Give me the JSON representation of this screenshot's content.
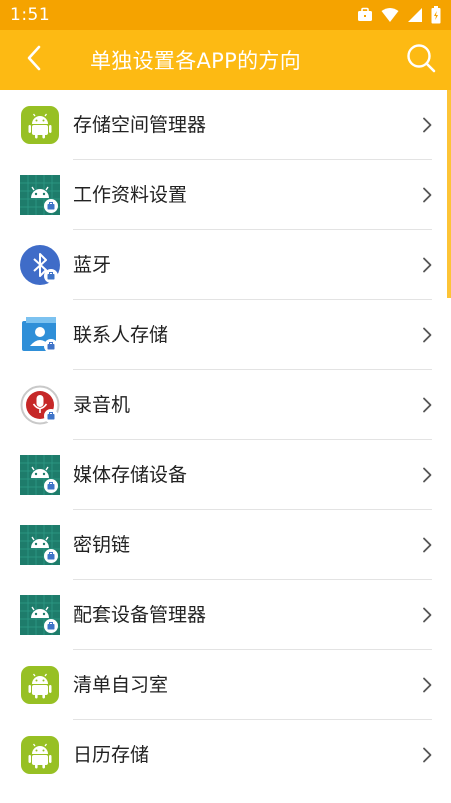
{
  "status_bar": {
    "time": "1:51",
    "icons": [
      "briefcase-icon",
      "wifi-icon",
      "signal-icon",
      "battery-icon"
    ]
  },
  "app_bar": {
    "title": "单独设置各APP的方向",
    "back_icon": "back-arrow-icon",
    "search_icon": "search-icon"
  },
  "colors": {
    "status_bar": "#F5A300",
    "app_bar": "#FDBA13",
    "divider": "#e3e3e3"
  },
  "items": [
    {
      "label": "存储空间管理器",
      "icon": "android-icon"
    },
    {
      "label": "工作资料设置",
      "icon": "android-work-icon"
    },
    {
      "label": "蓝牙",
      "icon": "bluetooth-icon"
    },
    {
      "label": "联系人存储",
      "icon": "contacts-icon"
    },
    {
      "label": "录音机",
      "icon": "microphone-icon"
    },
    {
      "label": "媒体存储设备",
      "icon": "android-work-icon"
    },
    {
      "label": "密钥链",
      "icon": "android-work-icon"
    },
    {
      "label": "配套设备管理器",
      "icon": "android-work-icon"
    },
    {
      "label": "清单自习室",
      "icon": "android-icon"
    },
    {
      "label": "日历存储",
      "icon": "android-icon"
    }
  ]
}
